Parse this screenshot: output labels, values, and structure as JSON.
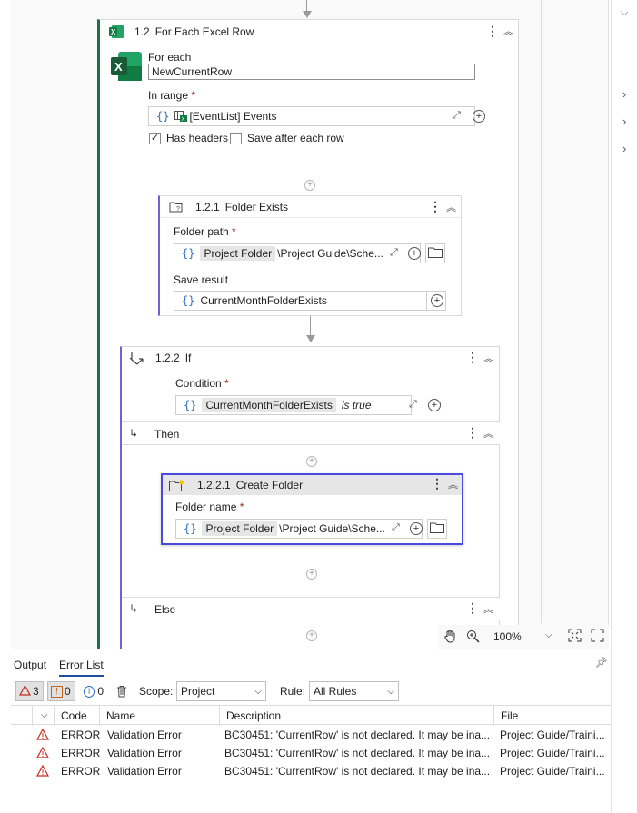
{
  "designer": {
    "for_each": {
      "number": "1.2",
      "title": "For Each Excel Row",
      "for_each_label": "For each",
      "for_each_value": "NewCurrentRow",
      "in_range_label": "In range",
      "required_mark": "*",
      "range_value": "[EventList] Events",
      "has_headers_label": "Has headers",
      "has_headers_checked": true,
      "save_after_label": "Save after each row",
      "save_after_checked": false
    },
    "folder_exists": {
      "number": "1.2.1",
      "title": "Folder Exists",
      "folder_path_label": "Folder path",
      "folder_path_chip": "Project Folder",
      "folder_path_rest": "\\Project Guide\\Sche...",
      "save_result_label": "Save result",
      "save_result_value": "CurrentMonthFolderExists"
    },
    "if": {
      "number": "1.2.2",
      "title": "If",
      "condition_label": "Condition",
      "condition_chip": "CurrentMonthFolderExists",
      "condition_op": "is true",
      "then_label": "Then",
      "else_label": "Else"
    },
    "create_folder": {
      "number": "1.2.2.1",
      "title": "Create Folder",
      "folder_name_label": "Folder name",
      "folder_name_chip": "Project Folder",
      "folder_name_rest": "\\Project Guide\\Sche..."
    },
    "zoom": "100%"
  },
  "panel": {
    "tabs": [
      "Output",
      "Error List"
    ],
    "active_tab": "Error List",
    "error_count": "3",
    "warning_count": "0",
    "info_count": "0",
    "scope_label": "Scope:",
    "scope_value": "Project",
    "rule_label": "Rule:",
    "rule_value": "All Rules",
    "columns": [
      "Code",
      "Name",
      "Description",
      "File"
    ],
    "rows": [
      {
        "code": "ERROR",
        "name": "Validation Error",
        "description": "BC30451: 'CurrentRow' is not declared. It may be ina...",
        "file": "Project Guide/Traini..."
      },
      {
        "code": "ERROR",
        "name": "Validation Error",
        "description": "BC30451: 'CurrentRow' is not declared. It may be ina...",
        "file": "Project Guide/Traini..."
      },
      {
        "code": "ERROR",
        "name": "Validation Error",
        "description": "BC30451: 'CurrentRow' is not declared. It may be ina...",
        "file": "Project Guide/Traini..."
      }
    ]
  },
  "colors": {
    "selected_border": "#4a4ae0",
    "excel_green": "#1d7044",
    "error_red": "#c42b1c",
    "info_blue": "#2d6fbf"
  }
}
